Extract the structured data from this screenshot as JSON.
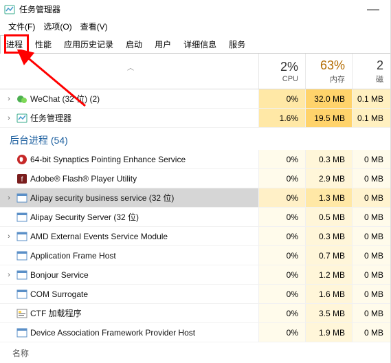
{
  "titlebar": {
    "title": "任务管理器"
  },
  "menubar": {
    "file": "文件(F)",
    "options": "选项(O)",
    "view": "查看(V)"
  },
  "tabs": {
    "processes": "进程",
    "performance": "性能",
    "history": "应用历史记录",
    "startup": "启动",
    "users": "用户",
    "details": "详细信息",
    "services": "服务"
  },
  "headers": {
    "name": "名称",
    "cpu_pct": "2%",
    "cpu_label": "CPU",
    "mem_pct": "63%",
    "mem_label": "内存",
    "extra_pct": "2",
    "extra_label": "磁"
  },
  "section": {
    "background": "后台进程 (54)"
  },
  "rows": [
    {
      "name": "WeChat (32 位) (2)",
      "cpu": "0%",
      "mem": "32.0 MB",
      "extra": "0.1 MB",
      "expandable": true,
      "hl": true,
      "icon": "wechat"
    },
    {
      "name": "任务管理器",
      "cpu": "1.6%",
      "mem": "19.5 MB",
      "extra": "0.1 MB",
      "expandable": true,
      "hl": true,
      "icon": "taskmgr"
    },
    {
      "name": "64-bit Synaptics Pointing Enhance Service",
      "cpu": "0%",
      "mem": "0.3 MB",
      "extra": "0 MB",
      "icon": "synaptics"
    },
    {
      "name": "Adobe® Flash® Player Utility",
      "cpu": "0%",
      "mem": "2.9 MB",
      "extra": "0 MB",
      "icon": "flash"
    },
    {
      "name": "Alipay security business service (32 位)",
      "cpu": "0%",
      "mem": "1.3 MB",
      "extra": "0 MB",
      "expandable": true,
      "sel": true,
      "icon": "win"
    },
    {
      "name": "Alipay Security Server (32 位)",
      "cpu": "0%",
      "mem": "0.5 MB",
      "extra": "0 MB",
      "icon": "win"
    },
    {
      "name": "AMD External Events Service Module",
      "cpu": "0%",
      "mem": "0.3 MB",
      "extra": "0 MB",
      "expandable": true,
      "icon": "win"
    },
    {
      "name": "Application Frame Host",
      "cpu": "0%",
      "mem": "0.7 MB",
      "extra": "0 MB",
      "icon": "win"
    },
    {
      "name": "Bonjour Service",
      "cpu": "0%",
      "mem": "1.2 MB",
      "extra": "0 MB",
      "expandable": true,
      "icon": "win"
    },
    {
      "name": "COM Surrogate",
      "cpu": "0%",
      "mem": "1.6 MB",
      "extra": "0 MB",
      "icon": "win"
    },
    {
      "name": "CTF 加载程序",
      "cpu": "0%",
      "mem": "3.5 MB",
      "extra": "0 MB",
      "icon": "ctf"
    },
    {
      "name": "Device Association Framework Provider Host",
      "cpu": "0%",
      "mem": "1.9 MB",
      "extra": "0 MB",
      "icon": "win"
    }
  ]
}
